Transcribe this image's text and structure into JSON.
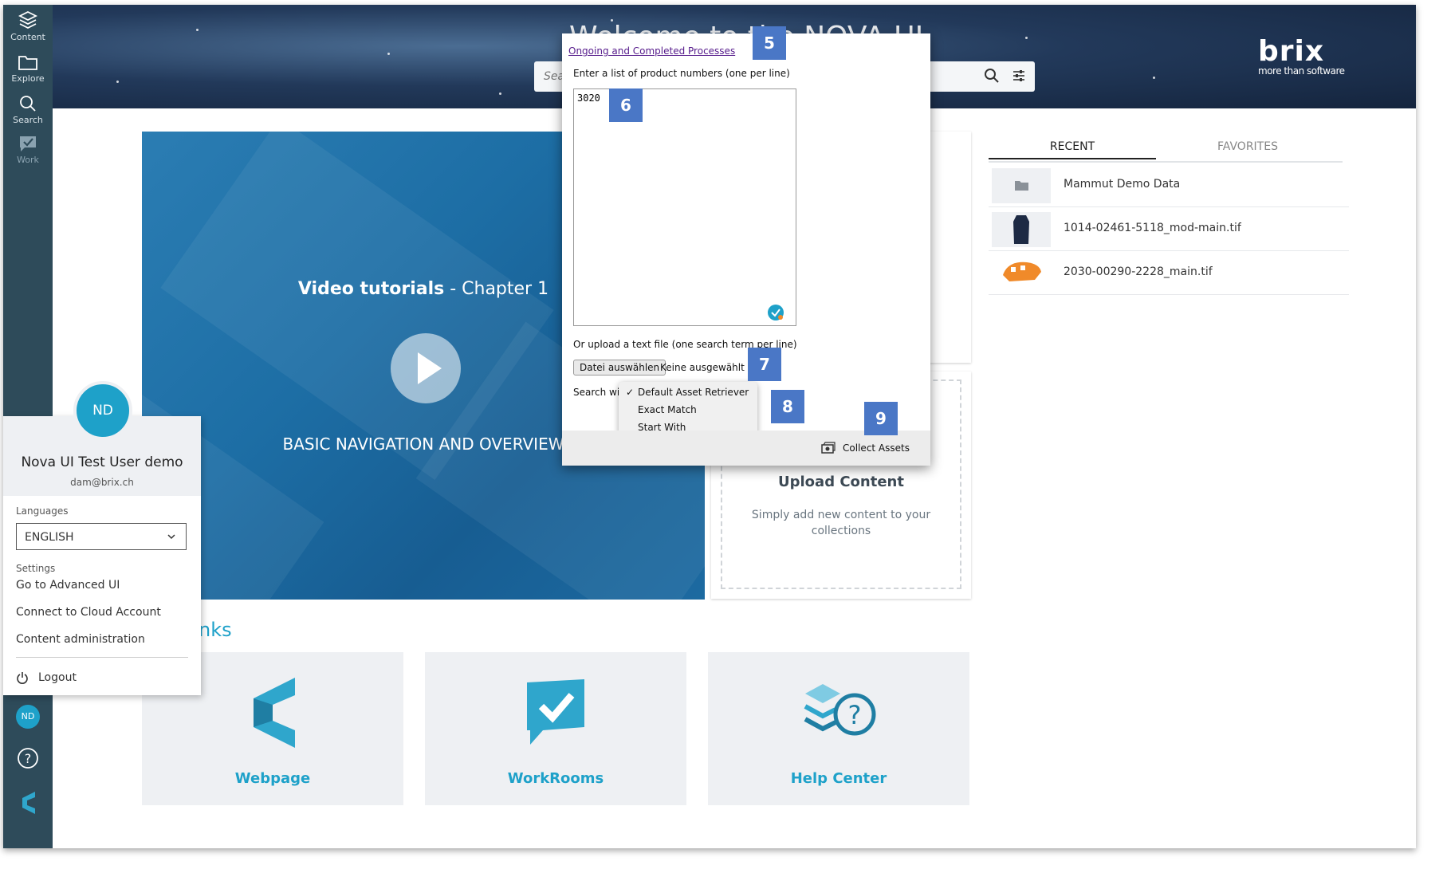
{
  "sidebar": {
    "items": [
      {
        "label": "Content",
        "icon": "layers-icon"
      },
      {
        "label": "Explore",
        "icon": "folder-icon"
      },
      {
        "label": "Search",
        "icon": "search-icon"
      },
      {
        "label": "Work",
        "icon": "check-bubble-icon"
      }
    ],
    "bottom": {
      "avatar_initials": "ND",
      "help_icon": "help-icon",
      "logo_icon": "brix-logo-icon"
    }
  },
  "header": {
    "title": "Welcome to the NOVA UI",
    "search_placeholder": "Search",
    "brand": {
      "logo": "brix",
      "tagline": "more than software"
    }
  },
  "video": {
    "title_bold": "Video tutorials",
    "title_rest": " - Chapter 1",
    "subtitle": "BASIC NAVIGATION AND OVERVIEW"
  },
  "upload": {
    "title": "Upload Content",
    "description": "Simply add new content to your collections"
  },
  "links": {
    "title": "Links",
    "title_visible": "nks",
    "cards": [
      {
        "label": "Webpage",
        "icon": "brix-c-logo-icon"
      },
      {
        "label": "WorkRooms",
        "icon": "workrooms-check-icon"
      },
      {
        "label": "Help Center",
        "icon": "help-center-icon"
      }
    ]
  },
  "recent_panel": {
    "tabs": [
      "RECENT",
      "FAVORITES"
    ],
    "active_tab": "RECENT",
    "items": [
      {
        "name": "Mammut Demo Data",
        "thumb": "folder-thumb"
      },
      {
        "name": "1014-02461-5118_mod-main.tif",
        "thumb": "jacket-thumb"
      },
      {
        "name": "2030-00290-2228_main.tif",
        "thumb": "helmet-thumb"
      }
    ]
  },
  "user_menu": {
    "initials": "ND",
    "name": "Nova UI Test User demo",
    "email": "dam@brix.ch",
    "languages_label": "Languages",
    "language_value": "ENGLISH",
    "settings_label": "Settings",
    "menu_items": [
      "Go to Advanced UI",
      "Connect to Cloud Account",
      "Content administration"
    ],
    "logout_label": "Logout"
  },
  "dialog": {
    "processes_link": "Ongoing and Completed Processes",
    "list_label": "Enter a list of product numbers (one per line)",
    "list_value": "3020",
    "upload_label": "Or upload a text file (one search term per line)",
    "file_button": "Datei auswählen",
    "file_status": "Keine ausgewählt",
    "search_with_label": "Search wit",
    "search_options": [
      "Default Asset Retriever",
      "Exact Match",
      "Start With"
    ],
    "search_selected": "Default Asset Retriever",
    "collect_label": "Collect Assets"
  },
  "markers": [
    "5",
    "6",
    "7",
    "8",
    "9"
  ],
  "colors": {
    "accent": "#1ea1c9",
    "sidebar": "#2e4b5a",
    "marker": "#4a77c6",
    "tile_bg": "#eef0f3"
  }
}
